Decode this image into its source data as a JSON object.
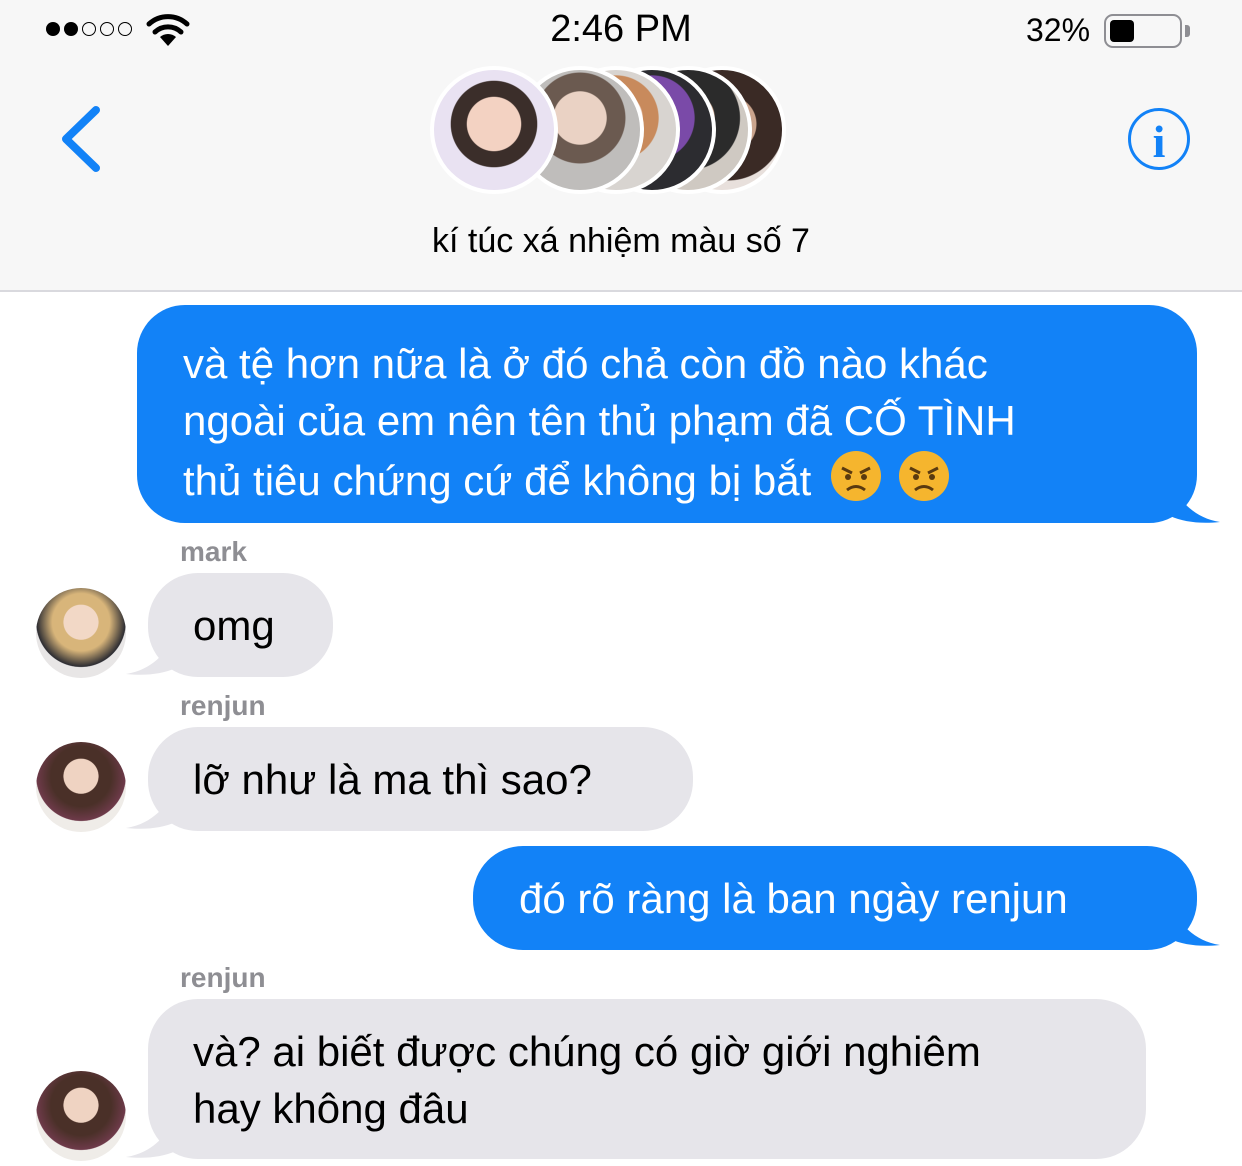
{
  "status_bar": {
    "time": "2:46 PM",
    "battery_percent": "32%",
    "battery_level": 0.32,
    "signal_bars_filled": 2,
    "signal_bars_total": 5
  },
  "header": {
    "back_icon": "chevron-left-icon",
    "info_icon": "info-icon",
    "info_glyph": "i",
    "group_name": "kí túc xá nhiệm màu số 7",
    "group_avatar_count": 6
  },
  "colors": {
    "accent": "#1282f7",
    "outgoing_bubble": "#1282f7",
    "incoming_bubble": "#e6e5ea",
    "sender_label": "#8e8e93"
  },
  "messages": [
    {
      "direction": "outgoing",
      "lines": [
        "và tệ hơn nữa là ở đó chả còn đồ nào khác",
        "ngoài của em nên tên thủ phạm đã CỐ TÌNH",
        "thủ tiêu chứng cứ để không bị bắt"
      ],
      "emojis": [
        "angry-face-icon",
        "angry-face-icon"
      ]
    },
    {
      "direction": "incoming",
      "sender": "mark",
      "lines": [
        "omg"
      ]
    },
    {
      "direction": "incoming",
      "sender": "renjun",
      "lines": [
        "lỡ như là ma thì sao?"
      ]
    },
    {
      "direction": "outgoing",
      "lines": [
        "đó rõ ràng là ban ngày renjun"
      ]
    },
    {
      "direction": "incoming",
      "sender": "renjun",
      "lines": [
        "và? ai biết được chúng có giờ giới nghiêm",
        "hay không đâu"
      ]
    }
  ]
}
